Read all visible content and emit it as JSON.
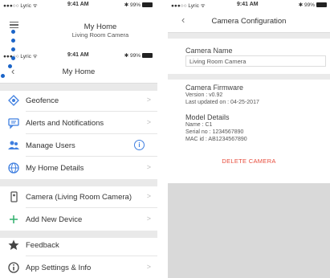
{
  "left_back": {
    "status": {
      "carrier": "●●●○○ Lyric ᯤ",
      "time": "9:41 AM",
      "battery": "✱ 99%"
    },
    "title": "My Home",
    "subtitle": "Living Room Camera"
  },
  "left_front": {
    "status": {
      "carrier": "●●●○○ Lyric ᯤ",
      "time": "9:41 AM",
      "battery": "✱ 99%"
    },
    "title": "My Home",
    "back_icon": "‹",
    "items": [
      {
        "label": "Geofence",
        "icon": "geofence-icon"
      },
      {
        "label": "Alerts and Notifications",
        "icon": "alerts-icon"
      },
      {
        "label": "Manage Users",
        "icon": "users-icon"
      },
      {
        "label": "My Home Details",
        "icon": "globe-icon"
      },
      {
        "label": "Camera (Living Room Camera)",
        "icon": "camera-device-icon"
      },
      {
        "label": "Add New Device",
        "icon": "plus-icon"
      },
      {
        "label": "Feedback",
        "icon": "star-icon"
      },
      {
        "label": "App Settings & Info",
        "icon": "info-icon"
      }
    ],
    "arrow": ">",
    "info_badge": "i",
    "accent": "#3f7fe0",
    "step_dot_color": "#1b64c8"
  },
  "right": {
    "status": {
      "carrier": "●●●○○ Lyric ᯤ",
      "time": "9:41 AM",
      "battery": "✱ 99%"
    },
    "title": "Camera Configuration",
    "back_icon": "‹",
    "camera_name_label": "Camera Name",
    "camera_name_value": "Living Room Camera",
    "firmware_label": "Camera Firmware",
    "firmware_version": "Version : v0.92",
    "firmware_updated": "Last updated on : 04-25-2017",
    "model_label": "Model Details",
    "model_name": "Name : C1",
    "model_serial": "Serial no : 1234567890",
    "model_mac": "MAC id : AB1234567890",
    "delete_label": "DELETE CAMERA",
    "delete_color": "#e74c3c"
  }
}
